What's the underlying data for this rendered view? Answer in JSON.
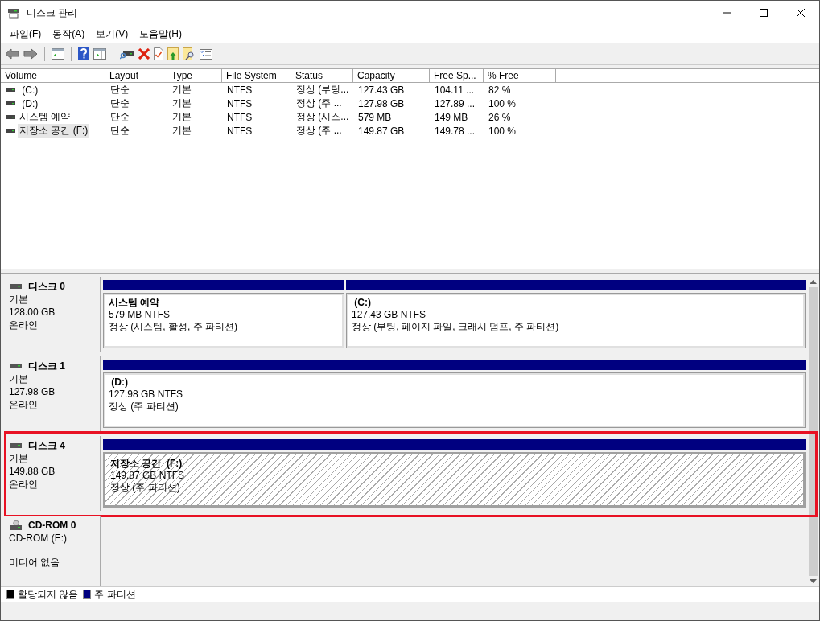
{
  "window": {
    "title": "디스크 관리"
  },
  "menu": [
    "파일(F)",
    "동작(A)",
    "보기(V)",
    "도움말(H)"
  ],
  "toolbar": [
    {
      "kind": "back"
    },
    {
      "kind": "forward"
    },
    {
      "kind": "sep"
    },
    {
      "kind": "tree"
    },
    {
      "kind": "sep"
    },
    {
      "kind": "help"
    },
    {
      "kind": "pane"
    },
    {
      "kind": "sep"
    },
    {
      "kind": "drive"
    },
    {
      "kind": "delete"
    },
    {
      "kind": "check"
    },
    {
      "kind": "folder-up"
    },
    {
      "kind": "folder-search"
    },
    {
      "kind": "list"
    }
  ],
  "table": {
    "columns": [
      "Volume",
      "Layout",
      "Type",
      "File System",
      "Status",
      "Capacity",
      "Free Sp...",
      "% Free"
    ],
    "rows": [
      {
        "cells": [
          " (C:)",
          "단순",
          "기본",
          "NTFS",
          "정상 (부팅...",
          "127.43 GB",
          "104.11 ...",
          "82 %"
        ],
        "selected": false
      },
      {
        "cells": [
          " (D:)",
          "단순",
          "기본",
          "NTFS",
          "정상 (주 ...",
          "127.98 GB",
          "127.89 ...",
          "100 %"
        ],
        "selected": false
      },
      {
        "cells": [
          "시스템 예약",
          "단순",
          "기본",
          "NTFS",
          "정상 (시스...",
          "579 MB",
          "149 MB",
          "26 %"
        ],
        "selected": false
      },
      {
        "cells": [
          "저장소 공간 (F:)",
          "단순",
          "기본",
          "NTFS",
          "정상 (주 ...",
          "149.87 GB",
          "149.78 ...",
          "100 %"
        ],
        "selected": true
      }
    ]
  },
  "disks": [
    {
      "kind": "basic",
      "name": "디스크 0",
      "info": [
        "기본",
        "128.00 GB",
        "온라인"
      ],
      "highlighted": false,
      "partitions": [
        {
          "name": "시스템 예약",
          "size": "579 MB NTFS",
          "status": "정상 (시스템, 활성, 주 파티션)",
          "selected": false
        },
        {
          "name": " (C:)",
          "size": "127.43 GB NTFS",
          "status": "정상 (부팅, 페이지 파일, 크래시 덤프, 주 파티션)",
          "selected": false
        }
      ]
    },
    {
      "kind": "basic",
      "name": "디스크 1",
      "info": [
        "기본",
        "127.98 GB",
        "온라인"
      ],
      "highlighted": false,
      "partitions": [
        {
          "name": " (D:)",
          "size": "127.98 GB NTFS",
          "status": "정상 (주 파티션)",
          "selected": false
        }
      ]
    },
    {
      "kind": "basic",
      "name": "디스크 4",
      "info": [
        "기본",
        "149.88 GB",
        "온라인"
      ],
      "highlighted": true,
      "partitions": [
        {
          "name": "저장소 공간  (F:)",
          "size": "149.87 GB NTFS",
          "status": "정상 (주 파티션)",
          "selected": true
        }
      ]
    },
    {
      "kind": "cdrom",
      "name": "CD-ROM 0",
      "info": [
        "CD-ROM (E:)",
        "미디어 없음"
      ],
      "highlighted": false
    }
  ],
  "legend": [
    {
      "label": "할당되지 않음",
      "color": "#000000"
    },
    {
      "label": "주 파티션",
      "color": "#000080"
    }
  ]
}
